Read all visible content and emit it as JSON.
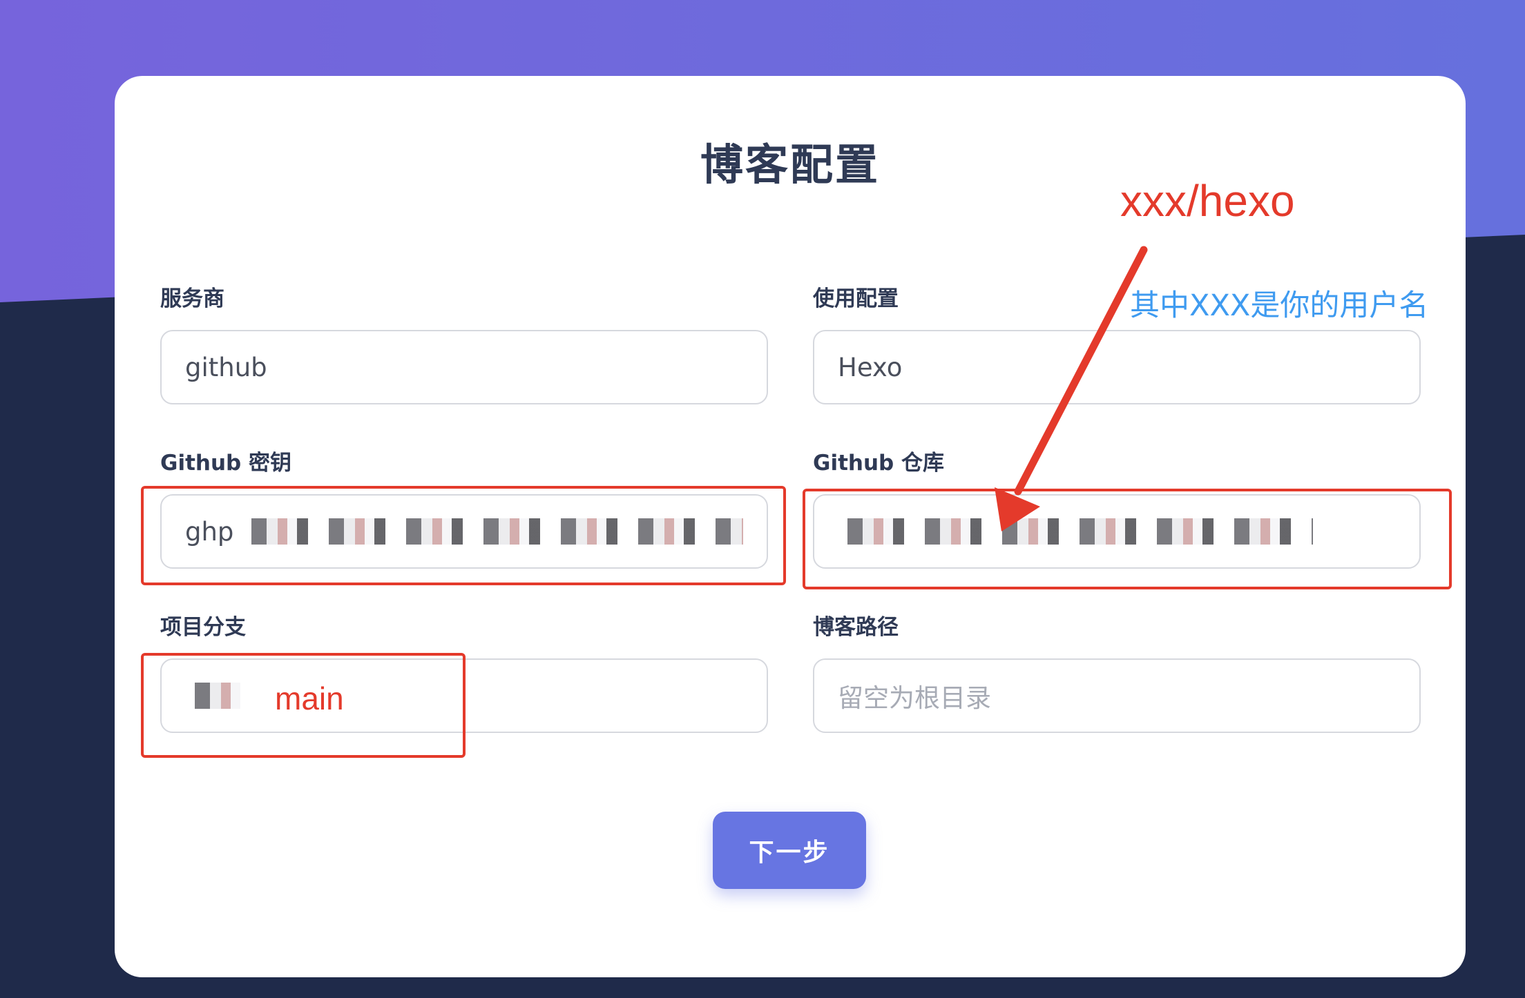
{
  "page": {
    "title": "博客配置"
  },
  "fields": [
    {
      "label": "服务商",
      "value": "github"
    },
    {
      "label": "使用配置",
      "value": "Hexo"
    },
    {
      "label": "Github 密钥",
      "value": "ghp"
    },
    {
      "label": "Github 仓库",
      "value": ""
    },
    {
      "label": "项目分支",
      "value": ""
    },
    {
      "label": "博客路径",
      "value": "",
      "placeholder": "留空为根目录"
    }
  ],
  "buttons": {
    "next": "下一步"
  },
  "annotations": {
    "repo_hint": "xxx/hexo",
    "repo_note": "其中XXX是你的用户名",
    "branch_hint": "main"
  },
  "colors": {
    "accent": "#6775e2",
    "annotation_red": "#e43a2b",
    "annotation_blue": "#3f9bf0",
    "background_top": "#7664dc",
    "background_bottom": "#1f2a4a"
  }
}
